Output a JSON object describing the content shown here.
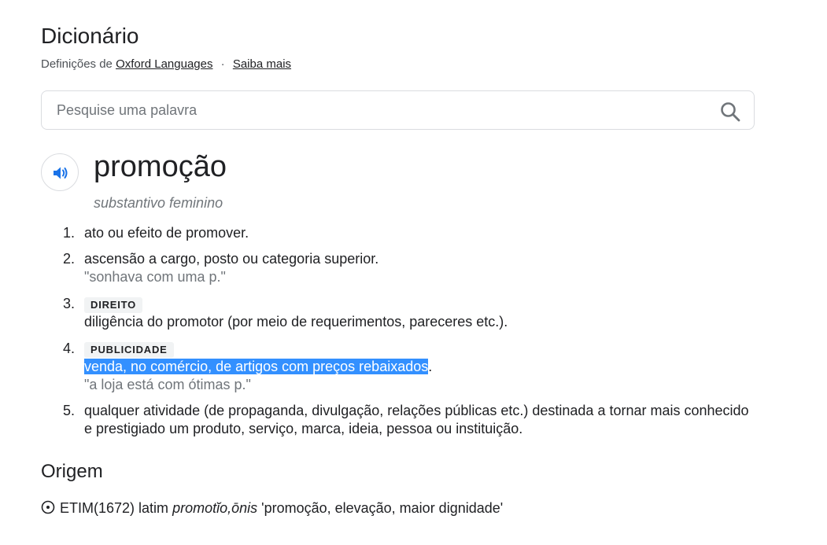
{
  "header": {
    "title": "Dicionário",
    "source_prefix": "Definições de",
    "source_link": "Oxford Languages",
    "separator": "·",
    "learn_more": "Saiba mais"
  },
  "search": {
    "placeholder": "Pesquise uma palavra",
    "value": ""
  },
  "entry": {
    "word": "promoção",
    "part_of_speech": "substantivo feminino",
    "definitions": [
      {
        "number": "1.",
        "label": "",
        "text": "ato ou efeito de promover.",
        "example": ""
      },
      {
        "number": "2.",
        "label": "",
        "text": "ascensão a cargo, posto ou categoria superior.",
        "example": "\"sonhava com uma p.\""
      },
      {
        "number": "3.",
        "label": "DIREITO",
        "text": "diligência do promotor (por meio de requerimentos, pareceres etc.).",
        "example": ""
      },
      {
        "number": "4.",
        "label": "PUBLICIDADE",
        "text_selected": "venda, no comércio, de artigos com preços rebaixados",
        "text_after": ".",
        "example": "\"a loja está com ótimas p.\""
      },
      {
        "number": "5.",
        "label": "",
        "text": "qualquer atividade (de propaganda, divulgação, relações públicas etc.) destinada a tornar mais conhecido e prestigiado um produto, serviço, marca, ideia, pessoa ou instituição.",
        "example": ""
      }
    ]
  },
  "origin": {
    "title": "Origem",
    "etym_prefix": "ETIM(1672) latim",
    "etym_word": "promotĭo,ōnis",
    "etym_meaning": "'promoção, elevação, maior dignidade'"
  },
  "colors": {
    "selection": "#3390ff",
    "speaker_icon": "#1a73e8",
    "example_text": "#70757a"
  },
  "icons": {
    "search": "search-icon",
    "speaker": "speaker-icon",
    "origin": "circle-dot-icon"
  }
}
